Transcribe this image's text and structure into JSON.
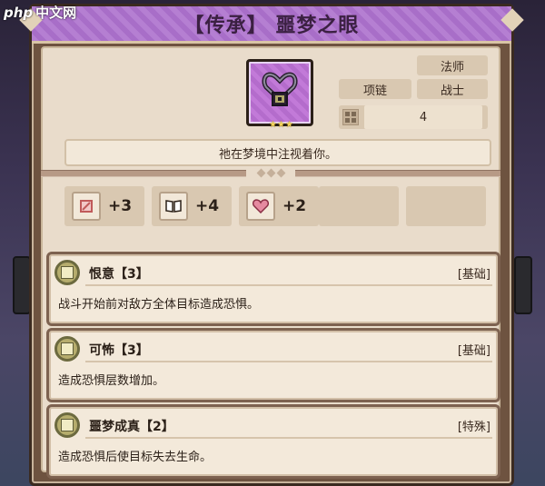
{
  "watermark": {
    "text_php": "php",
    "text_cn": "中文网"
  },
  "item": {
    "title": "【传承】 噩梦之眼",
    "rarity_color": "#b57fd2",
    "icon": "heart-necklace-icon",
    "star_rating": 3,
    "tags": {
      "class_mage": "法师",
      "slot": "项链",
      "class_warrior": "战士"
    },
    "cost_value": "4",
    "flavor_text": "祂在梦境中注视着你。"
  },
  "stats": [
    {
      "icon": "attack-icon",
      "value": "+3"
    },
    {
      "icon": "book-icon",
      "value": "+4"
    },
    {
      "icon": "heart-icon",
      "value": "+2"
    }
  ],
  "effects": [
    {
      "name": "恨意【3】",
      "type": "[基础]",
      "desc": "战斗开始前对敌方全体目标造成恐惧。"
    },
    {
      "name": "可怖【3】",
      "type": "[基础]",
      "desc": "造成恐惧层数增加。"
    },
    {
      "name": "噩梦成真【2】",
      "type": "[特殊]",
      "desc": "造成恐惧后使目标失去生命。"
    }
  ]
}
